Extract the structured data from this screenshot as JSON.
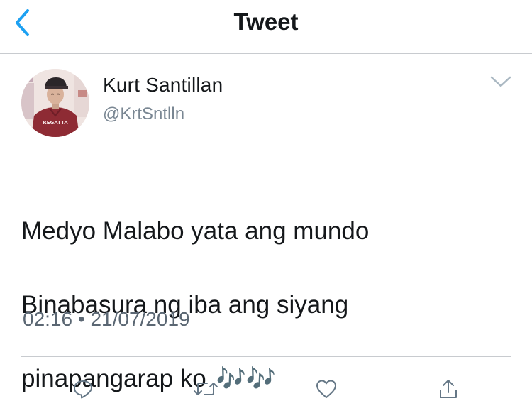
{
  "header": {
    "title": "Tweet",
    "back_icon": "chevron-left-icon",
    "accent_color": "#1da1f2"
  },
  "tweet": {
    "author_name": "Kurt Santillan",
    "author_handle": "@KrtSntlln",
    "text_lines": [
      "Medyo Malabo yata ang mundo",
      "Binabasura ng iba ang siyang",
      "pinapangarap ko"
    ],
    "emoji": "🎶🎶",
    "time": "02:16",
    "separator": "•",
    "date": "21/07/2019",
    "avatar_shirt_text": "REGATTA"
  },
  "actions": [
    {
      "name": "reply",
      "icon": "reply-icon"
    },
    {
      "name": "retweet",
      "icon": "retweet-icon"
    },
    {
      "name": "like",
      "icon": "heart-icon"
    },
    {
      "name": "share",
      "icon": "share-icon"
    }
  ],
  "colors": {
    "text": "#14171a",
    "secondary_text": "#7a8793",
    "icon_gray": "#657786",
    "divider": "#c8cbcf"
  }
}
